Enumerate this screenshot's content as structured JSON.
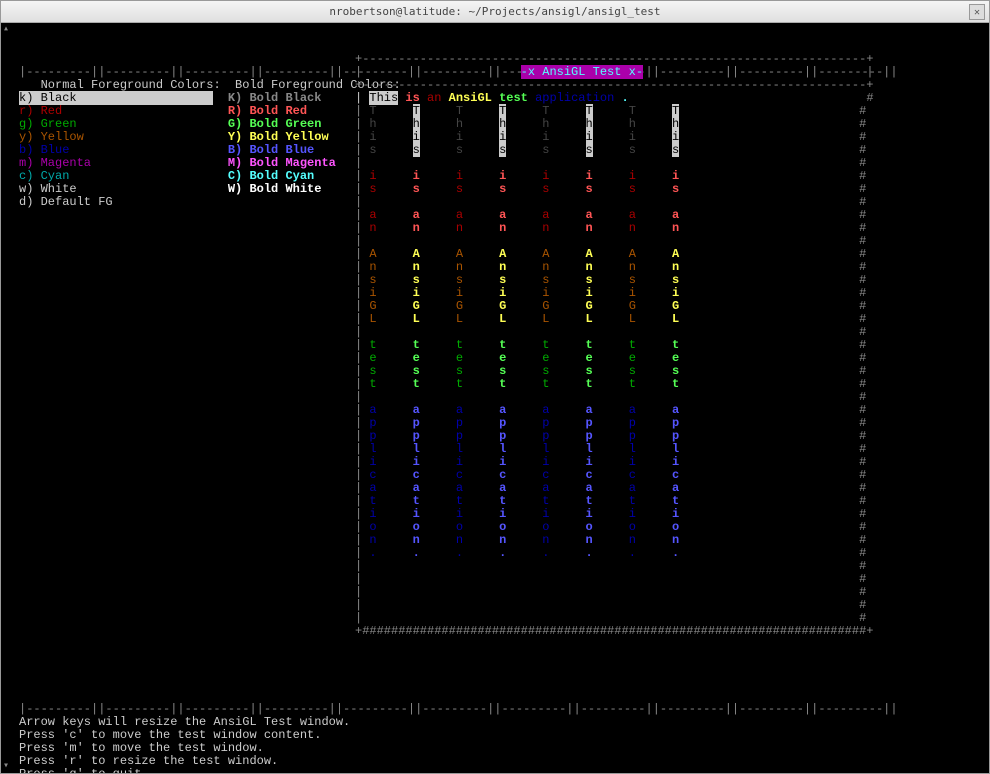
{
  "window": {
    "title": "nrobertson@latitude: ~/Projects/ansigl/ansigl_test"
  },
  "ruler": "|---------||---------||---------||---------||---------||---------||---------||---------||---------||---------||---------||",
  "headers": {
    "normal": "Normal Foreground Colors:",
    "bold": "Bold Foreground Colors:"
  },
  "normal_colors": [
    {
      "key": "k)",
      "name": "Black",
      "cls": "inv-white"
    },
    {
      "key": "r)",
      "name": "Red",
      "cls": "fg-red"
    },
    {
      "key": "g)",
      "name": "Green",
      "cls": "fg-green"
    },
    {
      "key": "y)",
      "name": "Yellow",
      "cls": "fg-yellow"
    },
    {
      "key": "b)",
      "name": "Blue",
      "cls": "fg-blue"
    },
    {
      "key": "m)",
      "name": "Magenta",
      "cls": "fg-magenta"
    },
    {
      "key": "c)",
      "name": "Cyan",
      "cls": "fg-cyan"
    },
    {
      "key": "w)",
      "name": "White",
      "cls": "fg-white"
    },
    {
      "key": "d)",
      "name": "Default FG",
      "cls": "fg-default"
    }
  ],
  "bold_colors": [
    {
      "key": "K)",
      "name": "Bold Black",
      "cls": "b-black"
    },
    {
      "key": "R)",
      "name": "Bold Red",
      "cls": "b-red"
    },
    {
      "key": "G)",
      "name": "Bold Green",
      "cls": "b-green"
    },
    {
      "key": "Y)",
      "name": "Bold Yellow",
      "cls": "b-yellow"
    },
    {
      "key": "B)",
      "name": "Bold Blue",
      "cls": "b-blue"
    },
    {
      "key": "M)",
      "name": "Bold Magenta",
      "cls": "b-magenta"
    },
    {
      "key": "C)",
      "name": "Bold Cyan",
      "cls": "b-cyan"
    },
    {
      "key": "W)",
      "name": "Bold White",
      "cls": "b-white"
    }
  ],
  "banner": "-x AnsiGL Test x-",
  "sentence_words": [
    {
      "text": "This",
      "cls": "inv-white"
    },
    {
      "text": "is",
      "cls": "b-red"
    },
    {
      "text": "an",
      "cls": "fg-red"
    },
    {
      "text": "AnsiGL",
      "cls": "b-yellow"
    },
    {
      "text": "test",
      "cls": "b-green"
    },
    {
      "text": "application",
      "cls": "fg-blue"
    },
    {
      "text": ".",
      "cls": "b-cyan"
    }
  ],
  "vertical_words": [
    "This",
    "is",
    "an",
    "AnsiGL",
    "test",
    "application."
  ],
  "vertical_word_classes": [
    "b-black",
    "fg-red",
    "fg-red",
    "b-yellow",
    "b-green",
    "fg-blue"
  ],
  "col_variants": [
    "dim",
    "bold",
    "dim",
    "bold",
    "dim",
    "bold",
    "dim",
    "bold"
  ],
  "help": [
    "Arrow keys will resize the AnsiGL Test window.",
    "Press 'c' to move the test window content.",
    "Press 'm' to move the test window.",
    "Press 'r' to resize the test window.",
    "Press 'q' to quit."
  ]
}
